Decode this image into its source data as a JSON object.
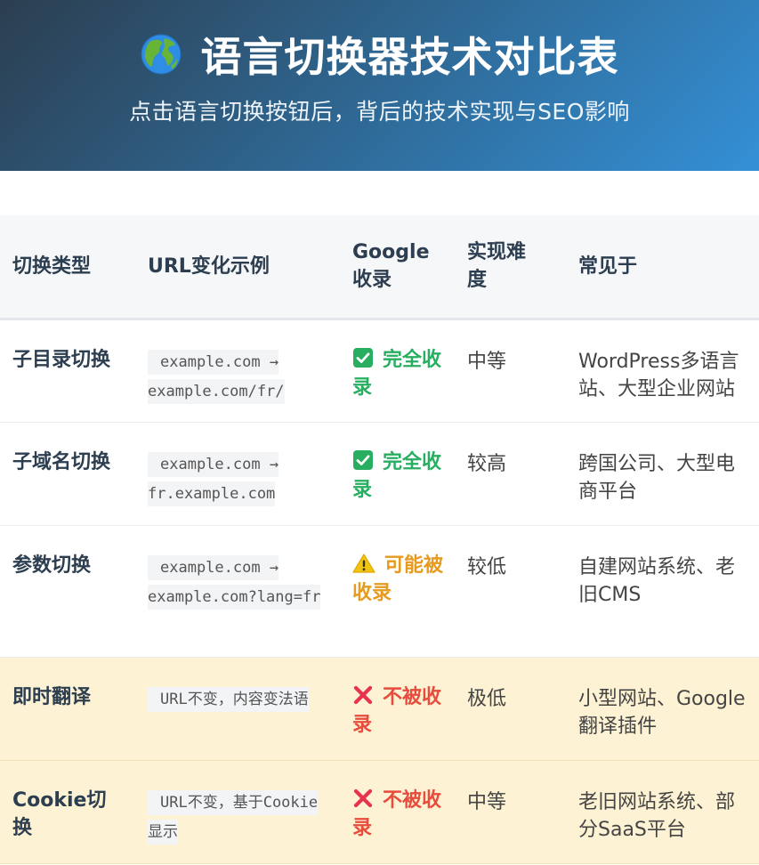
{
  "header": {
    "icon": "globe-icon",
    "title": "语言切换器技术对比表",
    "subtitle": "点击语言切换按钮后，背后的技术实现与SEO影响"
  },
  "table": {
    "headers": [
      "切换类型",
      "URL变化示例",
      "Google收录",
      "实现难度",
      "常见于"
    ],
    "rows": [
      {
        "type": "子目录切换",
        "url": "example.com → example.com/fr/",
        "index_icon": "check-icon",
        "index": "完全收录",
        "difficulty": "中等",
        "common": "WordPress多语言站、大型企业网站"
      },
      {
        "type": "子域名切换",
        "url": "example.com → fr.example.com",
        "index_icon": "check-icon",
        "index": "完全收录",
        "difficulty": "较高",
        "common": "跨国公司、大型电商平台"
      },
      {
        "type": "参数切换",
        "url": "example.com → example.com?lang=fr",
        "index_icon": "warning-icon",
        "index": "可能被收录",
        "difficulty": "较低",
        "common": "自建网站系统、老旧CMS"
      },
      {
        "type": "即时翻译",
        "url": "URL不变，内容变法语",
        "index_icon": "cross-icon",
        "index": "不被收录",
        "difficulty": "极低",
        "common": "小型网站、Google翻译插件"
      },
      {
        "type": "Cookie切换",
        "url": "URL不变，基于Cookie显示",
        "index_icon": "cross-icon",
        "index": "不被收录",
        "difficulty": "中等",
        "common": "老旧网站系统、部分SaaS平台"
      }
    ]
  },
  "colors": {
    "header_gradient_start": "#2c3e50",
    "header_gradient_end": "#3490d6",
    "full_index": "#27ae60",
    "maybe_index": "#e69b1e",
    "no_index": "#e74c3c",
    "highlight_row": "#fdf2d3"
  }
}
